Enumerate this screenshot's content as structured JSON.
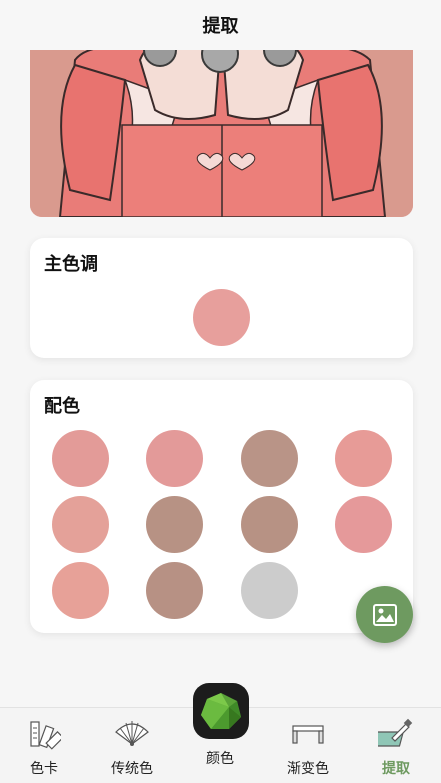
{
  "header": {
    "title": "提取"
  },
  "main_color": {
    "title": "主色调",
    "color": "#e79f9c"
  },
  "palette": {
    "title": "配色",
    "colors": [
      "#e39b98",
      "#e39a99",
      "#b99487",
      "#e79b97",
      "#e4a199",
      "#b79284",
      "#b79284",
      "#e5999a",
      "#e7a198",
      "#b79184",
      "#cccccc"
    ]
  },
  "tabs": [
    {
      "label": "色卡",
      "icon": "color-card-icon"
    },
    {
      "label": "传统色",
      "icon": "traditional-fan-icon"
    },
    {
      "label": "颜色",
      "icon": "color-gem-icon"
    },
    {
      "label": "渐变色",
      "icon": "gradient-bar-icon"
    },
    {
      "label": "提取",
      "icon": "extract-dropper-icon",
      "active": true
    }
  ],
  "fab": {
    "icon": "image-icon",
    "color": "#6e9a60"
  }
}
